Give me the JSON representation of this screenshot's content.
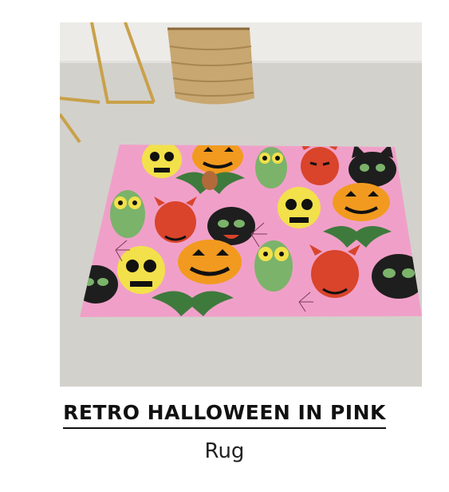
{
  "product": {
    "title": "RETRO HALLOWEEN IN PINK",
    "type": "Rug"
  },
  "colors": {
    "rug_background": "#f0a0c8",
    "floor": "#d3d1cc",
    "wall": "#ecebe8",
    "pumpkin": "#f29a1f",
    "skull": "#f2e14a",
    "devil": "#d9442b",
    "cat": "#1e1e1e",
    "owl": "#7bb36a",
    "bat": "#3f7a3d"
  }
}
